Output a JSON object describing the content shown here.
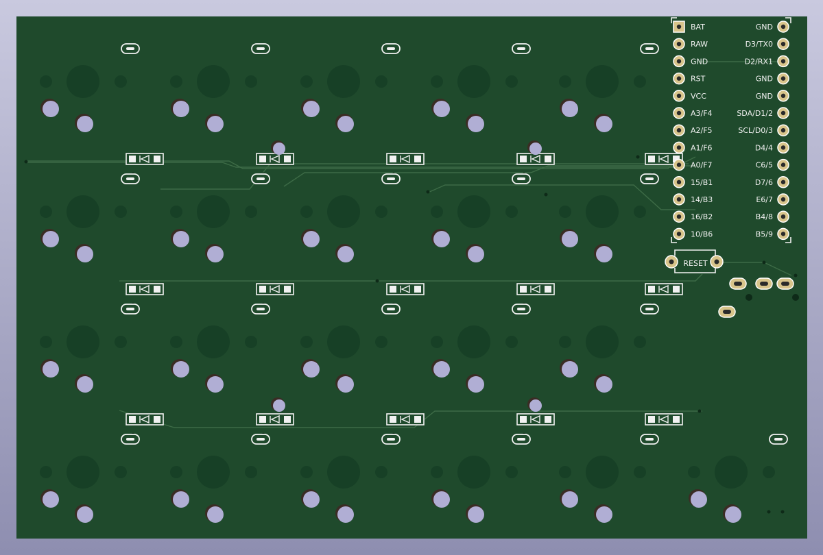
{
  "view": {
    "colors": {
      "background_top": "#c9c9df",
      "background_bottom": "#8e8eb0",
      "board": "#1f4a2c",
      "solder_mask_dark": "#174026",
      "hole": "#b0aed4",
      "silkscreen": "#f2f2f2",
      "pad_gold": "#d8c48a",
      "trace": "#3d6b46"
    }
  },
  "board": {
    "switch_grid": {
      "rows": 4,
      "columns": 5
    },
    "extra_switch": "bottom-right",
    "diode_symbol": "◼◁◼",
    "pro_micro": {
      "left_pins": [
        "BAT",
        "RAW",
        "GND",
        "RST",
        "VCC",
        "A3/F4",
        "A2/F5",
        "A1/F6",
        "A0/F7",
        "15/B1",
        "14/B3",
        "16/B2",
        "10/B6"
      ],
      "right_pins": [
        "GND",
        "D3/TX0",
        "D2/RX1",
        "GND",
        "GND",
        "SDA/D1/2",
        "SCL/D0/3",
        "D4/4",
        "C6/5",
        "D7/6",
        "E6/7",
        "B4/8",
        "B5/9"
      ]
    },
    "reset_label": "RESET"
  }
}
